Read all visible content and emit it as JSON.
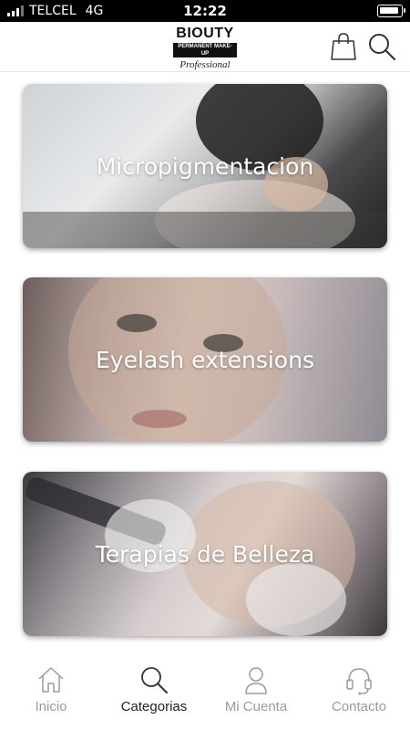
{
  "status_bar": {
    "carrier": "TELCEL",
    "network": "4G",
    "time": "12:22"
  },
  "header": {
    "logo_brand": "BIOUTY",
    "logo_tagline": "PERMANENT MAKE-UP",
    "logo_script": "Professional"
  },
  "categories": [
    {
      "label": "Micropigmentacion"
    },
    {
      "label": "Eyelash extensions"
    },
    {
      "label": "Terapias de Belleza"
    }
  ],
  "tabbar": {
    "active": "Categorias",
    "tabs": [
      {
        "label": "Inicio",
        "icon": "home-icon"
      },
      {
        "label": "Categorias",
        "icon": "search-icon"
      },
      {
        "label": "Mi Cuenta",
        "icon": "user-icon"
      },
      {
        "label": "Contacto",
        "icon": "headset-icon"
      }
    ]
  },
  "colors": {
    "tab_inactive": "#9b9b9b",
    "tab_active": "#222222",
    "status_bar": "#000000"
  }
}
